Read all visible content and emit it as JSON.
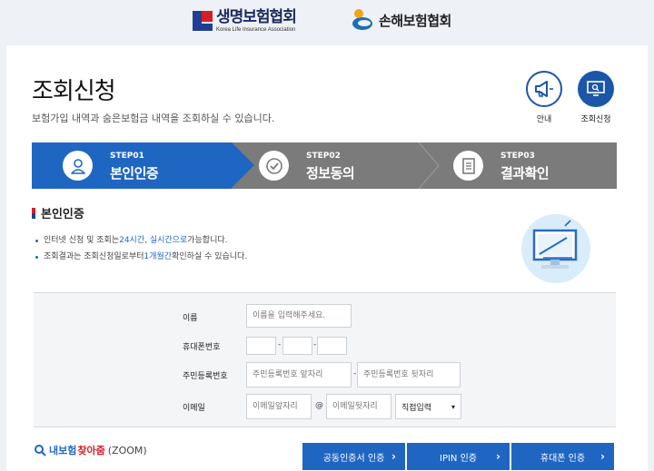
{
  "header": {
    "logo1_ko": "생명보험협회",
    "logo1_en": "Korea Life Insurance Association",
    "logo2_ko": "손해보험협회"
  },
  "page": {
    "title": "조회신청",
    "subtitle": "보험가입 내역과 숨은보험금 내역을 조회하실 수 있습니다."
  },
  "quick": {
    "guide_label": "안내",
    "apply_label": "조회신청"
  },
  "steps": [
    {
      "step": "STEP01",
      "label": "본인인증",
      "icon": "person-icon"
    },
    {
      "step": "STEP02",
      "label": "정보동의",
      "icon": "check-icon"
    },
    {
      "step": "STEP03",
      "label": "결과확인",
      "icon": "document-icon"
    }
  ],
  "section": {
    "title": "본인인증",
    "b1_pre": "인터넷 신청 및 조회는 ",
    "b1_hl": "24시간, 실시간으로",
    "b1_post": " 가능합니다.",
    "b2_pre": "조회결과는 조회신청일로부터 ",
    "b2_hl": "1개월간",
    "b2_post": " 확인하실 수 있습니다."
  },
  "form": {
    "name_label": "이름",
    "name_placeholder": "이름을 입력해주세요.",
    "phone_label": "휴대폰번호",
    "rrn_label": "주민등록번호",
    "rrn_front_placeholder": "주민등록번호 앞자리",
    "rrn_back_placeholder": "주민등록번호 뒷자리",
    "email_label": "이메일",
    "email_front_placeholder": "이메일앞자리",
    "email_at": "@",
    "email_back_placeholder": "이메일뒷자리",
    "email_domain_selected": "직접입력",
    "dash": "-"
  },
  "zoom": {
    "part1": "내보험",
    "part2": "찾아줌",
    "part3": "(ZOOM)"
  },
  "auth_buttons": [
    {
      "label": "공동인증서 인증"
    },
    {
      "label": "IPIN 인증"
    },
    {
      "label": "휴대폰 인증"
    }
  ],
  "colors": {
    "primary": "#1f66c2",
    "step_inactive": "#7b7b7b"
  }
}
